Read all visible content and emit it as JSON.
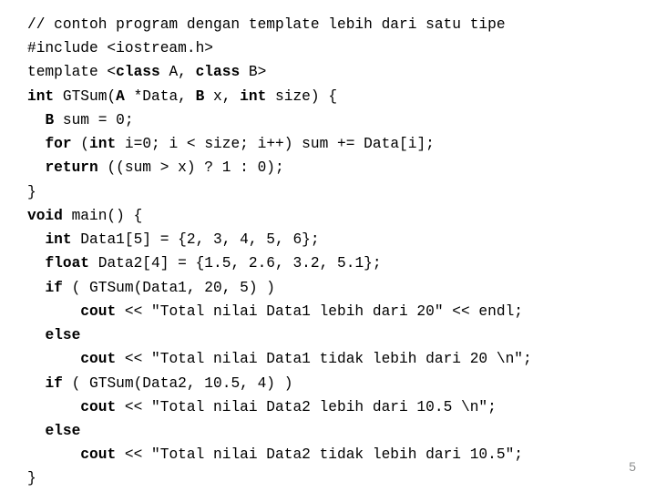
{
  "code": {
    "l01a": "// contoh program dengan template lebih dari satu tipe",
    "l02a": "#include <iostream.h>",
    "l03a": "template <",
    "l03b": "class",
    "l03c": " A, ",
    "l03d": "class",
    "l03e": " B>",
    "l04a": "int",
    "l04b": " GTSum(",
    "l04c": "A",
    "l04d": " *Data, ",
    "l04e": "B",
    "l04f": " x, ",
    "l04g": "int",
    "l04h": " size) {",
    "l05a": "  ",
    "l05b": "B",
    "l05c": " sum = 0;",
    "l06a": "  ",
    "l06b": "for",
    "l06c": " (",
    "l06d": "int",
    "l06e": " i=0; i < size; i++) sum += Data[i];",
    "l07a": "  ",
    "l07b": "return",
    "l07c": " ((sum > x) ? 1 : 0);",
    "l08a": "}",
    "l09a": "void",
    "l09b": " main() {",
    "l10a": "  ",
    "l10b": "int",
    "l10c": " Data1[5] = {2, 3, 4, 5, 6};",
    "l11a": "  ",
    "l11b": "float",
    "l11c": " Data2[4] = {1.5, 2.6, 3.2, 5.1};",
    "l12a": "  ",
    "l12b": "if",
    "l12c": " ( GTSum(Data1, 20, 5) )",
    "l13a": "      ",
    "l13b": "cout",
    "l13c": " << \"Total nilai Data1 lebih dari 20\" << endl;",
    "l14a": "  ",
    "l14b": "else",
    "l15a": "      ",
    "l15b": "cout",
    "l15c": " << \"Total nilai Data1 tidak lebih dari 20 \\n\";",
    "l16a": "  ",
    "l16b": "if",
    "l16c": " ( GTSum(Data2, 10.5, 4) )",
    "l17a": "      ",
    "l17b": "cout",
    "l17c": " << \"Total nilai Data2 lebih dari 10.5 \\n\";",
    "l18a": "  ",
    "l18b": "else",
    "l19a": "      ",
    "l19b": "cout",
    "l19c": " << \"Total nilai Data2 tidak lebih dari 10.5\";",
    "l20a": "}"
  },
  "page_number": "5"
}
